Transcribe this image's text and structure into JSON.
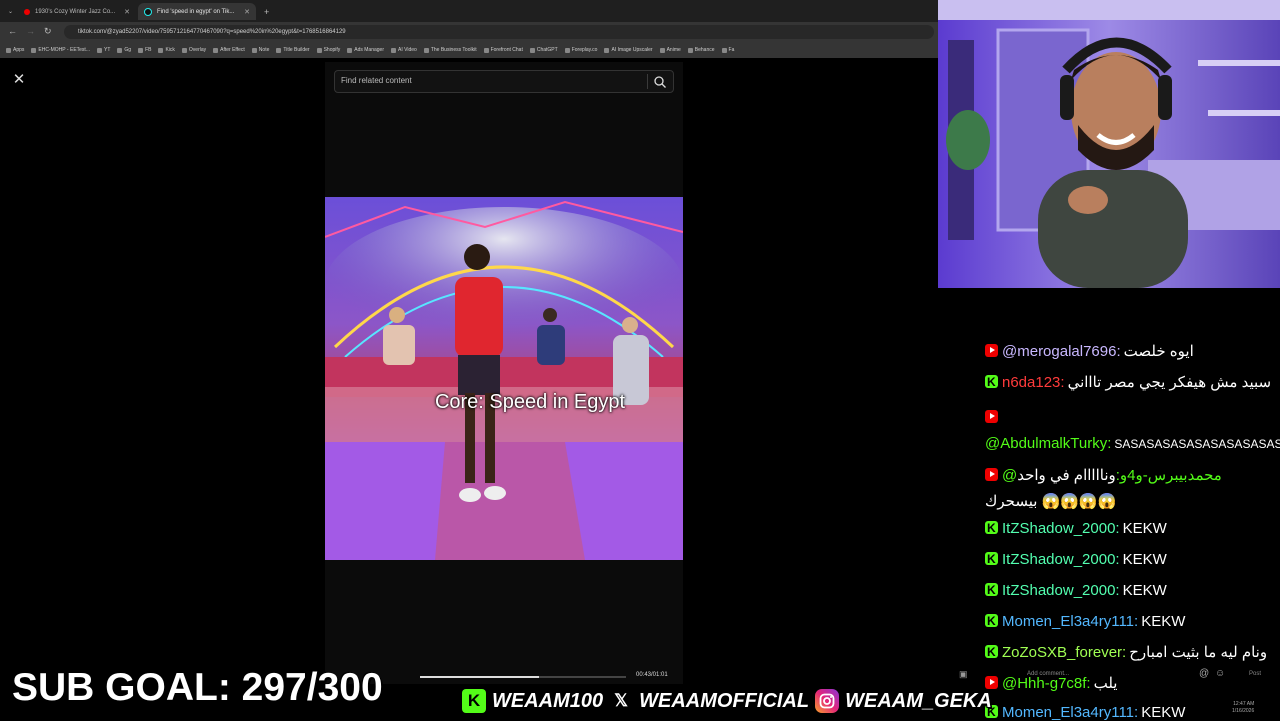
{
  "browser": {
    "tabs": [
      {
        "label": "1930's Cozy Winter Jazz Co..."
      },
      {
        "label": "Find 'speed in egypt' on Tik..."
      }
    ],
    "url": "tiktok.com/@zyad52207/video/7595712164770467090?q=speed%20in%20egypt&t=1768516864129",
    "bookmarks": [
      "Apps",
      "EHC-MOHP - EETest...",
      "YT",
      "Gg",
      "FB",
      "Kick",
      "Overlay",
      "After Effect",
      "Note",
      "Title Builder",
      "Shopify",
      "Ads Manager",
      "AI Video",
      "The Business Toolkit",
      "Forefront Chat",
      "ChatGPT",
      "Foreplay.co",
      "AI Image Upscaler",
      "Anime",
      "Behance",
      "Fa"
    ]
  },
  "tiktok": {
    "search_placeholder": "Find related content",
    "video_caption": "Core: Speed in Egypt",
    "timecode": "00:43/01:01",
    "progress_fraction": 0.58
  },
  "chat": {
    "messages": [
      {
        "platform": "youtube",
        "user": "@merogalal7696:",
        "text": "ايوه خلصت",
        "user_color": "#c9b8ff"
      },
      {
        "platform": "kick",
        "user": "n6da123:",
        "text": "سبيد مش هيفكر يجي مصر تاااني",
        "user_color": "#ff3b3b"
      },
      {
        "platform": "youtube",
        "user": "@AbdulmalkTurky:",
        "text": "SASASASASASASASASASASASASA",
        "user_color": "#53fc18"
      },
      {
        "platform": "youtube",
        "user": "@محمدبيبرس-و4و:",
        "text": "ونااااام في واحد بيسحرك 😱😱😱😱",
        "user_color": "#53fc18"
      },
      {
        "platform": "kick",
        "user": "ItZShadow_2000:",
        "text": "KEKW",
        "user_color": "#53ffb0"
      },
      {
        "platform": "kick",
        "user": "ItZShadow_2000:",
        "text": "KEKW",
        "user_color": "#53ffb0"
      },
      {
        "platform": "kick",
        "user": "ItZShadow_2000:",
        "text": "KEKW",
        "user_color": "#53ffb0"
      },
      {
        "platform": "kick",
        "user": "Momen_El3a4ry111:",
        "text": "KEKW",
        "user_color": "#53b8ff"
      },
      {
        "platform": "kick",
        "user": "ZoZoSXB_forever:",
        "text": "ونام ليه ما بثيت امبارح",
        "user_color": "#a0ff53"
      },
      {
        "platform": "youtube",
        "user": "@Hhh-g7c8f:",
        "text": "يلب",
        "user_color": "#53fc18"
      },
      {
        "platform": "kick",
        "user": "Momen_El3a4ry111:",
        "text": "KEKW",
        "user_color": "#53b8ff"
      }
    ],
    "comment_placeholder": "Add comment...",
    "post_label": "Post"
  },
  "overlay": {
    "sub_goal": "SUB GOAL: 297/300",
    "socials": [
      {
        "icon": "kick-icon",
        "handle": "WEAAM100"
      },
      {
        "icon": "x-icon",
        "handle": "WEAAMOFFICIAL"
      },
      {
        "icon": "instagram-icon",
        "handle": "WEAAM_GEKA"
      }
    ]
  },
  "taskbar": {
    "time": "12:47 AM",
    "date": "1/16/2026"
  },
  "colors": {
    "kick_green": "#53fc18",
    "youtube_red": "#ee0000",
    "stream_purple": "#7a4dff"
  }
}
